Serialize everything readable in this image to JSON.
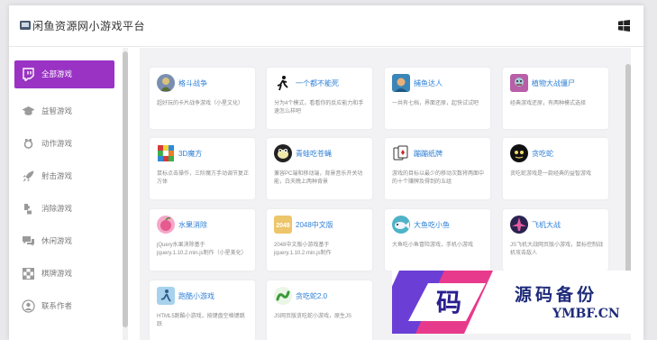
{
  "header": {
    "title": "闲鱼资源网小游戏平台",
    "logo_icon": "gamepad-icon",
    "windows_icon": "windows-icon"
  },
  "sidebar": {
    "accent_color": "#9a33c4",
    "items": [
      {
        "label": "全部游戏",
        "icon": "twitch-icon",
        "active": true
      },
      {
        "label": "益智游戏",
        "icon": "graduation-cap-icon",
        "active": false
      },
      {
        "label": "动作游戏",
        "icon": "dumbbell-icon",
        "active": false
      },
      {
        "label": "射击游戏",
        "icon": "rocket-icon",
        "active": false
      },
      {
        "label": "消除游戏",
        "icon": "puzzle-icon",
        "active": false
      },
      {
        "label": "休闲游戏",
        "icon": "chat-icon",
        "active": false
      },
      {
        "label": "棋牌游戏",
        "icon": "chess-board-icon",
        "active": false
      },
      {
        "label": "联系作者",
        "icon": "user-circle-icon",
        "active": false
      }
    ]
  },
  "games": [
    {
      "title": "格斗战争",
      "desc": "超好玩的卡片战争游戏（小星文化）",
      "icon": "warrior-icon"
    },
    {
      "title": "一个都不能死",
      "desc": "分为4个模式，看看你的反应能力和手速怎么样吧",
      "icon": "running-man-icon"
    },
    {
      "title": "捕鱼达人",
      "desc": "一共有七档，界面还原，起快试试吧",
      "icon": "fishing-icon"
    },
    {
      "title": "植物大战僵尸",
      "desc": "经典游戏还原，有两种模式选择",
      "icon": "zombie-icon"
    },
    {
      "title": "3D魔方",
      "desc": "鼠标点击操作，三阶魔方手动调节复正方体",
      "icon": "rubiks-cube-icon"
    },
    {
      "title": "青蛙吃苍蝇",
      "desc": "兼容PC端和移动端，背景音乐开关功能，白天晚上两种背景",
      "icon": "frog-icon"
    },
    {
      "title": "蹦蹦纸牌",
      "desc": "游戏的目标以最少的移动次数将两面中的十个赚牌及得到的五组",
      "icon": "cards-icon"
    },
    {
      "title": "贪吃蛇",
      "desc": "贪吃蛇游戏是一款经典的益智游戏",
      "icon": "snake-icon"
    },
    {
      "title": "水果消除",
      "desc": "jQuery水果消除基于jquery.1.10.2.min.js制作（小星美化）",
      "icon": "fruit-icon"
    },
    {
      "title": "2048中文版",
      "desc": "2048中文版小游戏基于jquery.1.10.2.min.js制作",
      "icon": "2048-icon"
    },
    {
      "title": "大鱼吃小鱼",
      "desc": "大鱼吃小鱼冒险游戏，手机小游戏",
      "icon": "big-fish-icon"
    },
    {
      "title": "飞机大战",
      "desc": "JS飞机大战网页版小游戏，鼠标控制战机攻击敌人",
      "icon": "plane-icon"
    },
    {
      "title": "跑酷小游戏",
      "desc": "HTML5跑酷小游戏，按键盘空格键跳跃",
      "icon": "parkour-icon"
    },
    {
      "title": "贪吃蛇2.0",
      "desc": "JS网页版贪吃蛇小游戏，原生JS",
      "icon": "snake2-icon"
    }
  ],
  "watermark": {
    "glyph": "码",
    "name": "源码备份",
    "domain": "YMBF.CN"
  }
}
